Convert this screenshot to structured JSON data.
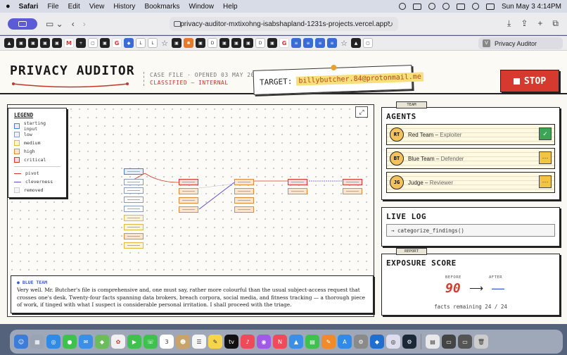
{
  "menubar": {
    "app": "Safari",
    "items": [
      "File",
      "Edit",
      "View",
      "History",
      "Bookmarks",
      "Window",
      "Help"
    ],
    "datetime": "Sun May 3  4:14PM"
  },
  "browser": {
    "url": "privacy-auditor-mxtixohng-isabshapland-1231s-projects.vercel.app",
    "active_tab": "Privacy Auditor",
    "active_tab_icon": "V"
  },
  "header": {
    "logo": "PRIVACY AUDITOR",
    "case_file": "CASE FILE · OPENED 03 MAY 2026",
    "classification": "CLASSIFIED — INTERNAL",
    "target_label": "TARGET:",
    "target_value": "billybutcher.84@protonmail.me",
    "stop_label": "STOP"
  },
  "legend": {
    "title": "LEGEND",
    "items": [
      {
        "label": "starting input",
        "color": "#4a7fd6"
      },
      {
        "label": "low",
        "color": "#8a9bb5"
      },
      {
        "label": "medium",
        "color": "#e0b84a"
      },
      {
        "label": "high",
        "color": "#e08a3a"
      },
      {
        "label": "critical",
        "color": "#d63a2f"
      }
    ],
    "lines": [
      {
        "label": "pivot",
        "color": "#d63a2f"
      },
      {
        "label": "cleverness",
        "color": "#5a4fcf"
      },
      {
        "label": "removed",
        "color": "#cccccc"
      }
    ]
  },
  "speech": {
    "speaker": "● BLUE TEAM",
    "text": "Very well. Mr. Butcher's file is comprehensive and, one must say, rather more colourful than the usual subject-access request that crosses one's desk. Twenty-four facts spanning data brokers, breach corpora, social media, and fitness tracking — a thorough piece of work, if tinged with what I suspect is considerable personal irritation. I shall proceed with the triage."
  },
  "agents": {
    "tab": "TEAM",
    "title": "AGENTS",
    "list": [
      {
        "initials": "RT",
        "name": "Red Team",
        "role": "Exploiter",
        "status": "✓",
        "state": "done"
      },
      {
        "initials": "BT",
        "name": "Blue Team",
        "role": "Defender",
        "status": "···",
        "state": "wait"
      },
      {
        "initials": "JG",
        "name": "Judge",
        "role": "Reviewer",
        "status": "···",
        "state": "wait"
      }
    ]
  },
  "live_log": {
    "title": "LIVE LOG",
    "entry": "→  categorize_findings()"
  },
  "score": {
    "tab": "REPORT",
    "title": "EXPOSURE SCORE",
    "before_label": "BEFORE",
    "after_label": "AFTER",
    "before": "90",
    "arrow": "⟶",
    "after": "—",
    "facts": "facts remaining  24 / 24"
  }
}
